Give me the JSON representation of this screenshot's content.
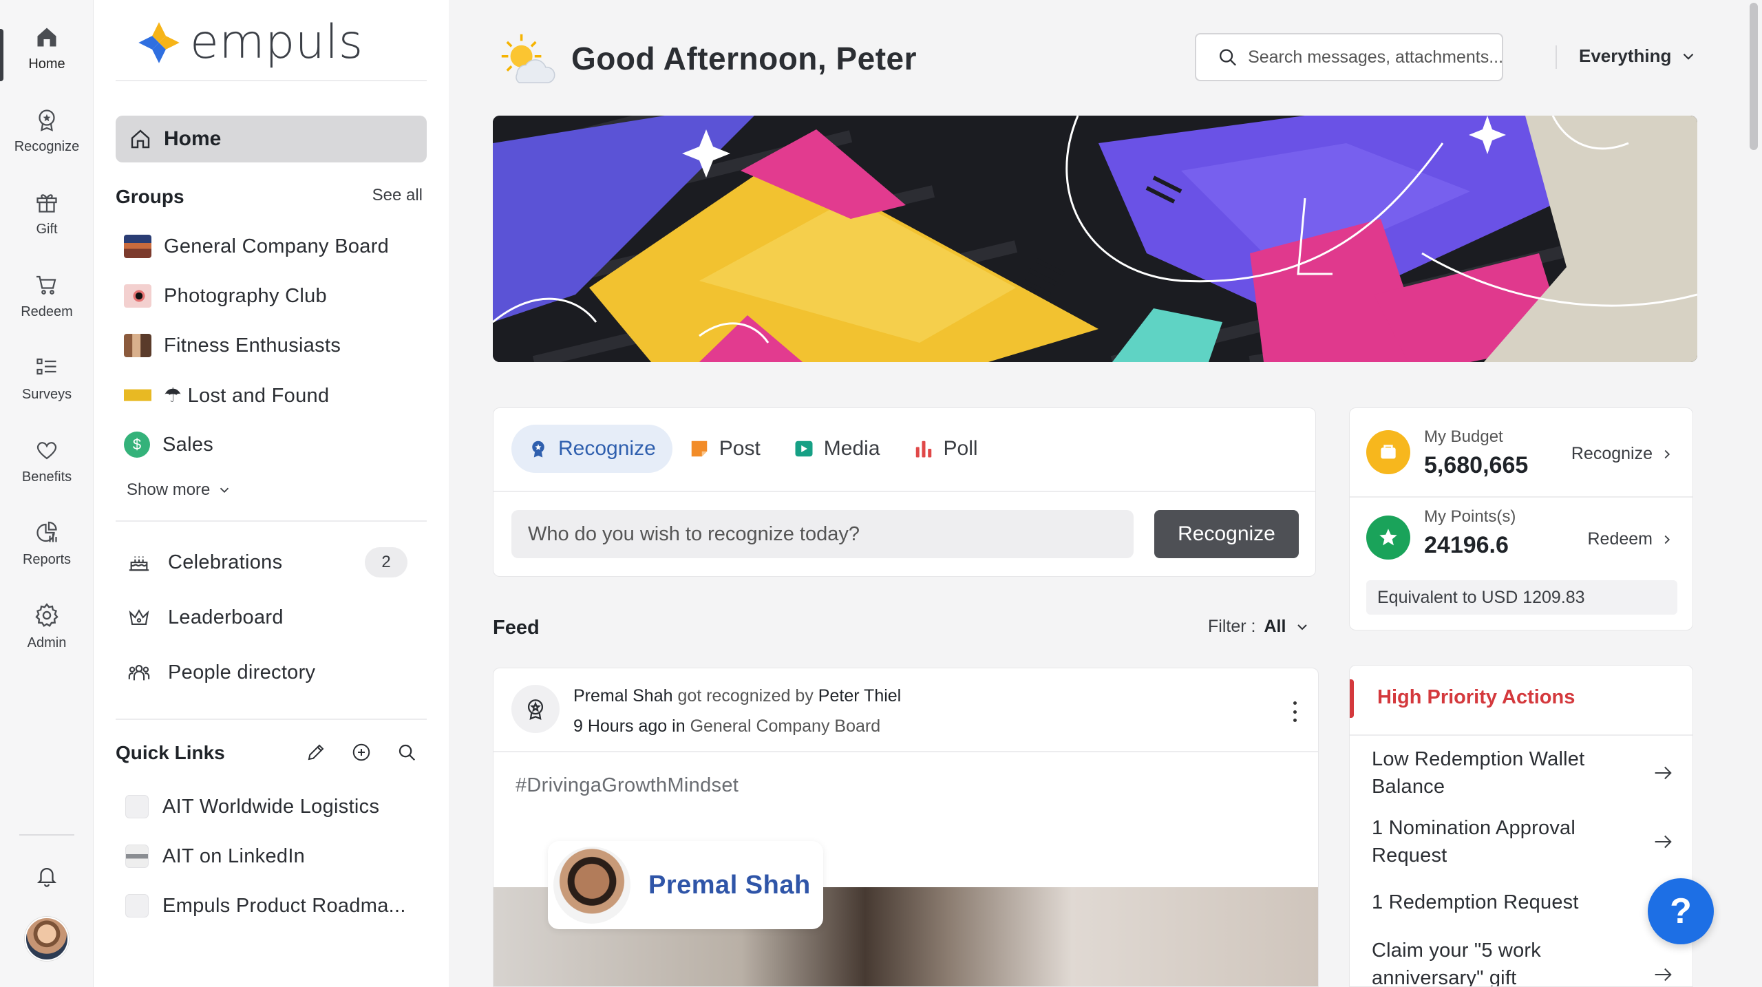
{
  "rail": {
    "items": [
      {
        "label": "Home",
        "icon": "home-icon"
      },
      {
        "label": "Recognize",
        "icon": "award-icon"
      },
      {
        "label": "Gift",
        "icon": "gift-icon"
      },
      {
        "label": "Redeem",
        "icon": "cart-icon"
      },
      {
        "label": "Surveys",
        "icon": "list-icon"
      },
      {
        "label": "Benefits",
        "icon": "heart-icon"
      },
      {
        "label": "Reports",
        "icon": "reports-icon"
      },
      {
        "label": "Admin",
        "icon": "gear-icon"
      }
    ]
  },
  "brand": {
    "name": "empuls"
  },
  "nav": {
    "home_label": "Home",
    "groups_title": "Groups",
    "see_all": "See all",
    "groups": [
      {
        "label": "General Company Board"
      },
      {
        "label": "Photography Club"
      },
      {
        "label": "Fitness Enthusiasts"
      },
      {
        "label": "☂ Lost and Found"
      },
      {
        "label": "Sales"
      }
    ],
    "show_more": "Show more",
    "links": [
      {
        "label": "Celebrations",
        "badge": "2"
      },
      {
        "label": "Leaderboard"
      },
      {
        "label": "People directory"
      }
    ],
    "quick_links_title": "Quick Links",
    "quick_links": [
      {
        "label": "AIT Worldwide Logistics"
      },
      {
        "label": "AIT on LinkedIn"
      },
      {
        "label": "Empuls Product Roadma..."
      }
    ]
  },
  "header": {
    "greeting": "Good Afternoon, Peter",
    "search_placeholder": "Search messages, attachments...",
    "scope": "Everything"
  },
  "composer": {
    "tabs": [
      {
        "label": "Recognize",
        "active": true
      },
      {
        "label": "Post"
      },
      {
        "label": "Media"
      },
      {
        "label": "Poll"
      }
    ],
    "input_placeholder": "Who do you wish to recognize today?",
    "button": "Recognize"
  },
  "feed": {
    "title": "Feed",
    "filter_label": "Filter :",
    "filter_value": "All",
    "post": {
      "recipient": "Premal Shah",
      "action": "got recognized by",
      "giver": "Peter Thiel",
      "time": "9 Hours ago",
      "in_word": "in",
      "group": "General Company Board",
      "hashtag": "#DrivingaGrowthMindset",
      "chip_name": "Premal Shah"
    }
  },
  "wallet": {
    "budget_label": "My Budget",
    "budget_value": "5,680,665",
    "budget_link": "Recognize",
    "points_label": "My Points(s)",
    "points_value": "24196.6",
    "points_link": "Redeem",
    "equivalent": "Equivalent to USD 1209.83"
  },
  "actions": {
    "title": "High Priority Actions",
    "items": [
      {
        "label": "Low Redemption Wallet Balance"
      },
      {
        "label": "1 Nomination Approval Request"
      },
      {
        "label": "1 Redemption Request"
      },
      {
        "label": "Claim your \"5 work anniversary\" gift"
      }
    ]
  },
  "help": {
    "label": "?"
  },
  "colors": {
    "accent": "#2f5fae",
    "danger": "#d4393d",
    "help": "#1d6fe5"
  }
}
